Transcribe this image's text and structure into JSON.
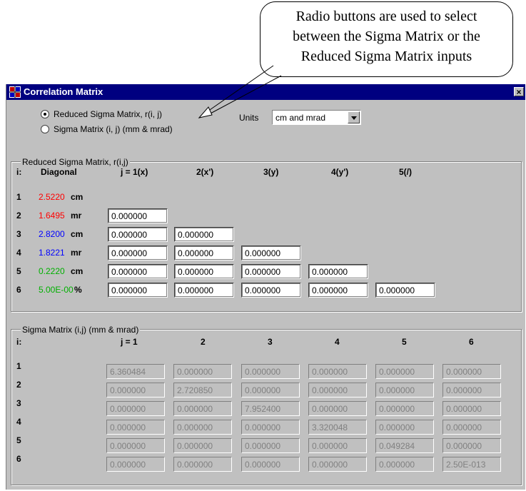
{
  "callout": {
    "lines": [
      "Radio buttons are used to select",
      "between the Sigma Matrix or the",
      "Reduced Sigma Matrix inputs"
    ]
  },
  "window": {
    "title": "Correlation Matrix",
    "close_label": "×"
  },
  "mode": {
    "options": [
      "Reduced Sigma Matrix, r(i, j)",
      "Sigma Matrix (i, j) (mm & mrad)"
    ],
    "selected_index": 0
  },
  "units": {
    "label": "Units",
    "value": "cm and mrad"
  },
  "reduced": {
    "group_title": "Reduced Sigma Matrix, r(i,j)",
    "header_i": "i:",
    "header_diagonal": "Diagonal",
    "columns": [
      "j = 1(x)",
      "2(x')",
      "3(y)",
      "4(y')",
      "5(/)"
    ],
    "rows": [
      {
        "i": "1",
        "diag": "2.5220",
        "unit": "cm",
        "color": "#ff0000",
        "cells": []
      },
      {
        "i": "2",
        "diag": "1.6495",
        "unit": "mr",
        "color": "#ff0000",
        "cells": [
          "0.000000"
        ]
      },
      {
        "i": "3",
        "diag": "2.8200",
        "unit": "cm",
        "color": "#0000ff",
        "cells": [
          "0.000000",
          "0.000000"
        ]
      },
      {
        "i": "4",
        "diag": "1.8221",
        "unit": "mr",
        "color": "#0000ff",
        "cells": [
          "0.000000",
          "0.000000",
          "0.000000"
        ]
      },
      {
        "i": "5",
        "diag": "0.2220",
        "unit": "cm",
        "color": "#00b000",
        "cells": [
          "0.000000",
          "0.000000",
          "0.000000",
          "0.000000"
        ]
      },
      {
        "i": "6",
        "diag": "5.00E-00",
        "unit": "%",
        "color": "#00b000",
        "cells": [
          "0.000000",
          "0.000000",
          "0.000000",
          "0.000000",
          "0.000000"
        ]
      }
    ]
  },
  "sigma": {
    "group_title": "Sigma Matrix (i,j) (mm & mrad)",
    "header_i": "i:",
    "columns": [
      "j = 1",
      "2",
      "3",
      "4",
      "5",
      "6"
    ],
    "rows": [
      {
        "i": "1",
        "cells": [
          "6.360484",
          "0.000000",
          "0.000000",
          "0.000000",
          "0.000000",
          "0.000000"
        ]
      },
      {
        "i": "2",
        "cells": [
          "0.000000",
          "2.720850",
          "0.000000",
          "0.000000",
          "0.000000",
          "0.000000"
        ]
      },
      {
        "i": "3",
        "cells": [
          "0.000000",
          "0.000000",
          "7.952400",
          "0.000000",
          "0.000000",
          "0.000000"
        ]
      },
      {
        "i": "4",
        "cells": [
          "0.000000",
          "0.000000",
          "0.000000",
          "3.320048",
          "0.000000",
          "0.000000"
        ]
      },
      {
        "i": "5",
        "cells": [
          "0.000000",
          "0.000000",
          "0.000000",
          "0.000000",
          "0.049284",
          "0.000000"
        ]
      },
      {
        "i": "6",
        "cells": [
          "0.000000",
          "0.000000",
          "0.000000",
          "0.000000",
          "0.000000",
          "2.50E-013"
        ]
      }
    ]
  }
}
